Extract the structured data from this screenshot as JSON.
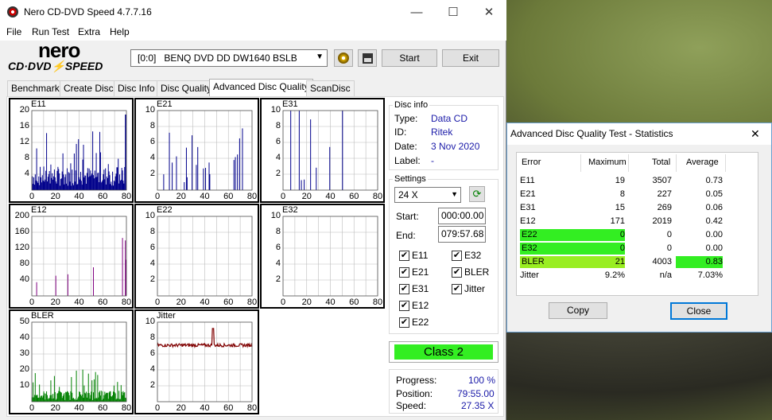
{
  "window": {
    "title": "Nero CD-DVD Speed 4.7.7.16",
    "minimize_glyph": "—",
    "maximize_glyph": "☐",
    "close_glyph": "✕"
  },
  "menu": [
    "File",
    "Run Test",
    "Extra",
    "Help"
  ],
  "logo": {
    "line1": "nero",
    "line2": "CD·DVD⚡SPEED"
  },
  "toolbar": {
    "drive": "[0:0]   BENQ DVD DD DW1640 BSLB",
    "start_label": "Start",
    "exit_label": "Exit"
  },
  "tabs": [
    "Benchmark",
    "Create Disc",
    "Disc Info",
    "Disc Quality",
    "Advanced Disc Quality",
    "ScanDisc"
  ],
  "active_tab": "Advanced Disc Quality",
  "disc_info": {
    "heading": "Disc info",
    "type_label": "Type:",
    "type": "Data CD",
    "id_label": "ID:",
    "id": "Ritek",
    "date_label": "Date:",
    "date": "3 Nov 2020",
    "label_label": "Label:",
    "label": "-"
  },
  "settings": {
    "heading": "Settings",
    "speed": "24 X",
    "start_label": "Start:",
    "start": "000:00.00",
    "end_label": "End:",
    "end": "079:57.68",
    "checks_left": [
      "E11",
      "E21",
      "E31",
      "E12",
      "E22"
    ],
    "checks_right": [
      "E32",
      "BLER",
      "Jitter"
    ]
  },
  "class_label": "Class 2",
  "progress": {
    "progress_label": "Progress:",
    "progress": "100 %",
    "position_label": "Position:",
    "position": "79:55.00",
    "speed_label": "Speed:",
    "speed": "27.35 X"
  },
  "charts": [
    {
      "name": "E11",
      "yticks": [
        "20",
        "16",
        "12",
        "8",
        "4"
      ],
      "xticks": [
        "0",
        "20",
        "40",
        "60",
        "80"
      ],
      "color": "#00008b",
      "ymax": 20
    },
    {
      "name": "E21",
      "yticks": [
        "10",
        "8",
        "6",
        "4",
        "2"
      ],
      "xticks": [
        "0",
        "20",
        "40",
        "60",
        "80"
      ],
      "color": "#00008b",
      "ymax": 10
    },
    {
      "name": "E31",
      "yticks": [
        "10",
        "8",
        "6",
        "4",
        "2"
      ],
      "xticks": [
        "0",
        "20",
        "40",
        "60",
        "80"
      ],
      "color": "#00008b",
      "ymax": 10
    },
    {
      "name": "E12",
      "yticks": [
        "200",
        "160",
        "120",
        "80",
        "40"
      ],
      "xticks": [
        "0",
        "20",
        "40",
        "60",
        "80"
      ],
      "color": "#800080",
      "ymax": 200
    },
    {
      "name": "E22",
      "yticks": [
        "10",
        "8",
        "6",
        "4",
        "2"
      ],
      "xticks": [
        "0",
        "20",
        "40",
        "60",
        "80"
      ],
      "color": "#800080",
      "ymax": 10
    },
    {
      "name": "E32",
      "yticks": [
        "10",
        "8",
        "6",
        "4",
        "2"
      ],
      "xticks": [
        "0",
        "20",
        "40",
        "60",
        "80"
      ],
      "color": "#800080",
      "ymax": 10
    },
    {
      "name": "BLER",
      "yticks": [
        "50",
        "40",
        "30",
        "20",
        "10"
      ],
      "xticks": [
        "0",
        "20",
        "40",
        "60",
        "80"
      ],
      "color": "#008000",
      "ymax": 50
    },
    {
      "name": "Jitter",
      "yticks": [
        "10",
        "8",
        "6",
        "4",
        "2"
      ],
      "xticks": [
        "0",
        "20",
        "40",
        "60",
        "80"
      ],
      "color": "#800000",
      "ymax": 10
    }
  ],
  "stats": {
    "title": "Advanced Disc Quality Test - Statistics",
    "headers": [
      "Error",
      "Maximum",
      "Total",
      "Average"
    ],
    "rows": [
      {
        "error": "E11",
        "max": "19",
        "total": "3507",
        "avg": "0.73",
        "hl_max": "",
        "hl_avg": ""
      },
      {
        "error": "E21",
        "max": "8",
        "total": "227",
        "avg": "0.05",
        "hl_max": "",
        "hl_avg": ""
      },
      {
        "error": "E31",
        "max": "15",
        "total": "269",
        "avg": "0.06",
        "hl_max": "",
        "hl_avg": ""
      },
      {
        "error": "E12",
        "max": "171",
        "total": "2019",
        "avg": "0.42",
        "hl_max": "",
        "hl_avg": ""
      },
      {
        "error": "E22",
        "max": "0",
        "total": "0",
        "avg": "0.00",
        "hl_max": "#33ee22",
        "hl_avg": ""
      },
      {
        "error": "E32",
        "max": "0",
        "total": "0",
        "avg": "0.00",
        "hl_max": "#33ee22",
        "hl_avg": ""
      },
      {
        "error": "BLER",
        "max": "21",
        "total": "4003",
        "avg": "0.83",
        "hl_max": "#99ee22",
        "hl_avg": "#33ee22"
      },
      {
        "error": "Jitter",
        "max": "9.2%",
        "total": "n/a",
        "avg": "7.03%",
        "hl_max": "",
        "hl_avg": ""
      }
    ],
    "copy_label": "Copy",
    "close_label": "Close"
  }
}
